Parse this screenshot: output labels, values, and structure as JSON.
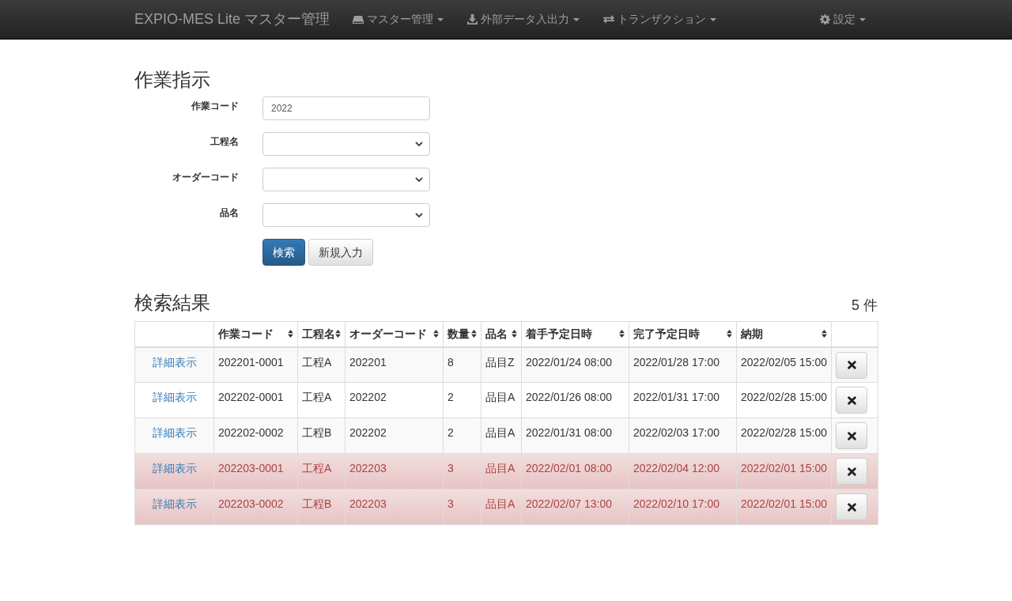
{
  "navbar": {
    "brand": "EXPIO-MES Lite マスター管理",
    "menus": [
      {
        "label": "マスター管理"
      },
      {
        "label": "外部データ入出力"
      },
      {
        "label": "トランザクション"
      }
    ],
    "settings": {
      "label": "設定"
    }
  },
  "form": {
    "title": "作業指示",
    "fields": [
      {
        "label": "作業コード",
        "kind": "input",
        "value": "2022"
      },
      {
        "label": "工程名",
        "kind": "select"
      },
      {
        "label": "オーダーコード",
        "kind": "select"
      },
      {
        "label": "品名",
        "kind": "select"
      }
    ],
    "buttons": [
      "検索",
      "新規入力"
    ]
  },
  "results": {
    "title": "検索結果",
    "count": "5 件",
    "columns": [
      "作業コード",
      "工程名",
      "オーダーコード",
      "数量",
      "品名",
      "着手予定日時",
      "完了予定日時",
      "納期"
    ],
    "rows": [
      {
        "link": "詳細表示",
        "overdue": false,
        "cells": [
          "202201-0001",
          "工程A",
          "202201",
          "8",
          "品目Z",
          "2022/01/24 08:00",
          "2022/01/28 17:00",
          "2022/02/05 15:00"
        ]
      },
      {
        "link": "詳細表示",
        "overdue": false,
        "cells": [
          "202202-0001",
          "工程A",
          "202202",
          "2",
          "品目A",
          "2022/01/26 08:00",
          "2022/01/31 17:00",
          "2022/02/28 15:00"
        ]
      },
      {
        "link": "詳細表示",
        "overdue": false,
        "cells": [
          "202202-0002",
          "工程B",
          "202202",
          "2",
          "品目A",
          "2022/01/31 08:00",
          "2022/02/03 17:00",
          "2022/02/28 15:00"
        ]
      },
      {
        "link": "詳細表示",
        "overdue": true,
        "cells": [
          "202203-0001",
          "工程A",
          "202203",
          "3",
          "品目A",
          "2022/02/01 08:00",
          "2022/02/04 12:00",
          "2022/02/01 15:00"
        ]
      },
      {
        "link": "詳細表示",
        "overdue": true,
        "cells": [
          "202203-0002",
          "工程B",
          "202203",
          "3",
          "品目A",
          "2022/02/07 13:00",
          "2022/02/10 17:00",
          "2022/02/01 15:00"
        ]
      }
    ]
  }
}
